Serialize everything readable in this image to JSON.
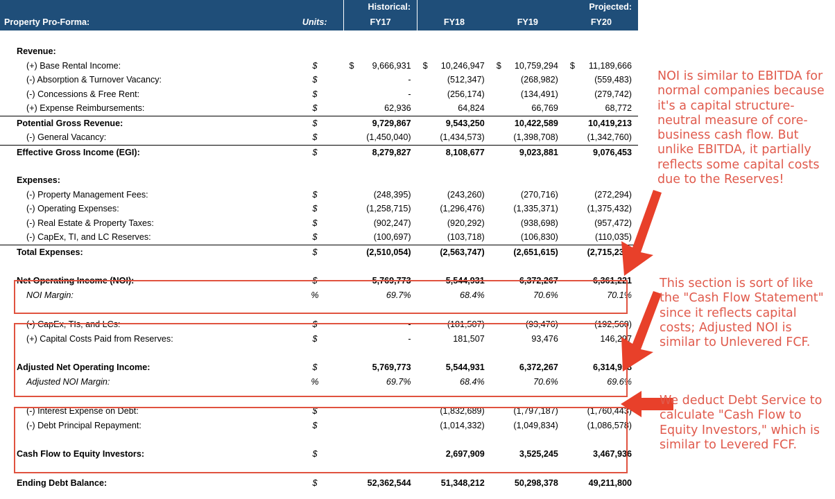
{
  "header": {
    "title": "Property Pro-Forma:",
    "units_label": "Units:",
    "historical_label": "Historical:",
    "projected_label": "Projected:",
    "periods": [
      "FY17",
      "FY18",
      "FY19",
      "FY20"
    ],
    "band_color": "#1f4e79"
  },
  "annotations": {
    "accent_color": "#e05a4c",
    "noi": "NOI is similar to EBITDA for normal companies because it's a capital structure-neutral measure of core-business cash flow. But unlike EBITDA, it partially reflects some capital costs due to the Reserves!",
    "adjusted_noi": "This section is sort of like the \"Cash Flow Statement\" since it reflects capital costs; Adjusted NOI is similar to Unlevered FCF.",
    "cash_flow_equity": "We deduct Debt Service to calculate \"Cash Flow to Equity Investors,\" which is similar to Levered FCF."
  },
  "sections": {
    "revenue_title": "Revenue:",
    "expenses_title": "Expenses:"
  },
  "rows": {
    "base_rental_income": {
      "label": "(+) Base Rental Income:",
      "units": "$",
      "fy17": "9,666,931",
      "fy18": "10,246,947",
      "fy19": "10,759,294",
      "fy20": "11,189,666",
      "dollar_prefix": "$"
    },
    "absorption_turnover_vacancy": {
      "label": "(-) Absorption & Turnover Vacancy:",
      "units": "$",
      "fy17": "-",
      "fy18": "(512,347)",
      "fy19": "(268,982)",
      "fy20": "(559,483)"
    },
    "concessions_free_rent": {
      "label": "(-) Concessions & Free Rent:",
      "units": "$",
      "fy17": "-",
      "fy18": "(256,174)",
      "fy19": "(134,491)",
      "fy20": "(279,742)"
    },
    "expense_reimbursements": {
      "label": "(+) Expense Reimbursements:",
      "units": "$",
      "fy17": "62,936",
      "fy18": "64,824",
      "fy19": "66,769",
      "fy20": "68,772"
    },
    "potential_gross_revenue": {
      "label": "Potential Gross Revenue:",
      "units": "$",
      "fy17": "9,729,867",
      "fy18": "9,543,250",
      "fy19": "10,422,589",
      "fy20": "10,419,213"
    },
    "general_vacancy": {
      "label": "(-) General Vacancy:",
      "units": "$",
      "fy17": "(1,450,040)",
      "fy18": "(1,434,573)",
      "fy19": "(1,398,708)",
      "fy20": "(1,342,760)"
    },
    "effective_gross_income": {
      "label": "Effective Gross Income (EGI):",
      "units": "$",
      "fy17": "8,279,827",
      "fy18": "8,108,677",
      "fy19": "9,023,881",
      "fy20": "9,076,453"
    },
    "property_management_fees": {
      "label": "(-) Property Management Fees:",
      "units": "$",
      "fy17": "(248,395)",
      "fy18": "(243,260)",
      "fy19": "(270,716)",
      "fy20": "(272,294)"
    },
    "operating_expenses": {
      "label": "(-) Operating Expenses:",
      "units": "$",
      "fy17": "(1,258,715)",
      "fy18": "(1,296,476)",
      "fy19": "(1,335,371)",
      "fy20": "(1,375,432)"
    },
    "real_estate_property_taxes": {
      "label": "(-) Real Estate & Property Taxes:",
      "units": "$",
      "fy17": "(902,247)",
      "fy18": "(920,292)",
      "fy19": "(938,698)",
      "fy20": "(957,472)"
    },
    "capex_ti_lc_reserves": {
      "label": "(-) CapEx, TI, and LC Reserves:",
      "units": "$",
      "fy17": "(100,697)",
      "fy18": "(103,718)",
      "fy19": "(106,830)",
      "fy20": "(110,035)"
    },
    "total_expenses": {
      "label": "Total Expenses:",
      "units": "$",
      "fy17": "(2,510,054)",
      "fy18": "(2,563,747)",
      "fy19": "(2,651,615)",
      "fy20": "(2,715,232)"
    },
    "net_operating_income": {
      "label": "Net Operating Income (NOI):",
      "units": "$",
      "fy17": "5,769,773",
      "fy18": "5,544,931",
      "fy19": "6,372,267",
      "fy20": "6,361,221"
    },
    "noi_margin": {
      "label": "NOI Margin:",
      "units": "%",
      "fy17": "69.7%",
      "fy18": "68.4%",
      "fy19": "70.6%",
      "fy20": "70.1%"
    },
    "capex_tis_lcs": {
      "label": "(-) CapEx, TIs, and LCs:",
      "units": "$",
      "fy17": "-",
      "fy18": "(181,507)",
      "fy19": "(93,476)",
      "fy20": "(192,560)"
    },
    "capital_costs_paid_from_reserves": {
      "label": "(+) Capital Costs Paid from Reserves:",
      "units": "$",
      "fy17": "-",
      "fy18": "181,507",
      "fy19": "93,476",
      "fy20": "146,297"
    },
    "adjusted_net_operating_income": {
      "label": "Adjusted Net Operating Income:",
      "units": "$",
      "fy17": "5,769,773",
      "fy18": "5,544,931",
      "fy19": "6,372,267",
      "fy20": "6,314,958"
    },
    "adjusted_noi_margin": {
      "label": "Adjusted NOI Margin:",
      "units": "%",
      "fy17": "69.7%",
      "fy18": "68.4%",
      "fy19": "70.6%",
      "fy20": "69.6%"
    },
    "interest_expense_on_debt": {
      "label": "(-) Interest Expense on Debt:",
      "units": "$",
      "fy17": "",
      "fy18": "(1,832,689)",
      "fy19": "(1,797,187)",
      "fy20": "(1,760,443)"
    },
    "debt_principal_repayment": {
      "label": "(-) Debt Principal Repayment:",
      "units": "$",
      "fy17": "",
      "fy18": "(1,014,332)",
      "fy19": "(1,049,834)",
      "fy20": "(1,086,578)"
    },
    "cash_flow_to_equity_investors": {
      "label": "Cash Flow to Equity Investors:",
      "units": "$",
      "fy17": "",
      "fy18": "2,697,909",
      "fy19": "3,525,245",
      "fy20": "3,467,936"
    },
    "ending_debt_balance": {
      "label": "Ending Debt Balance:",
      "units": "$",
      "fy17": "52,362,544",
      "fy18": "51,348,212",
      "fy19": "50,298,378",
      "fy20": "49,211,800"
    }
  }
}
